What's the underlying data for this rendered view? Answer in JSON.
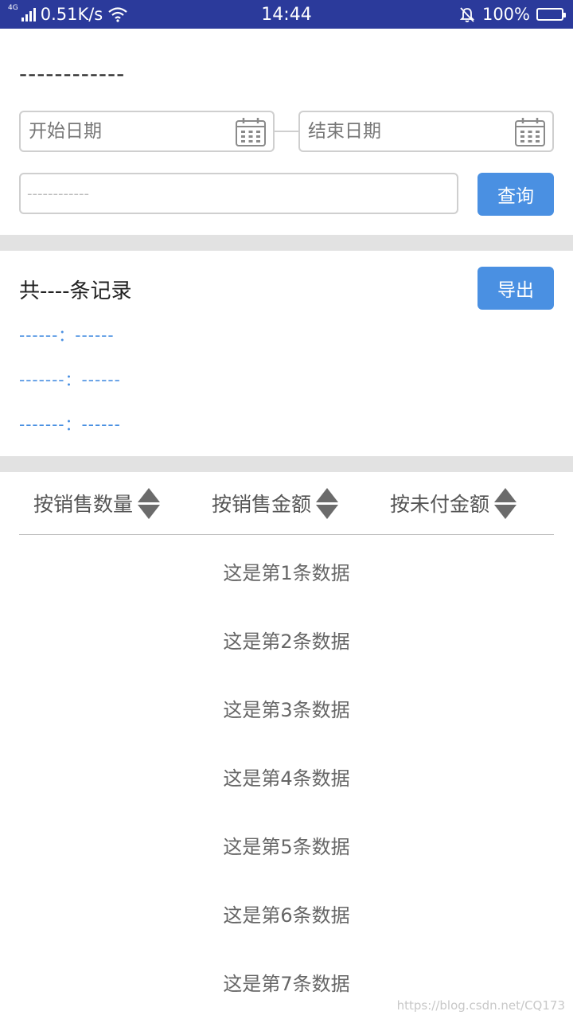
{
  "statusbar": {
    "network_type": "4G",
    "speed": "0.51K/s",
    "time": "14:44",
    "battery": "100%",
    "battery_level": 1.0
  },
  "filter": {
    "title": "------------",
    "start_date_placeholder": "开始日期",
    "end_date_placeholder": "结束日期",
    "search_placeholder": "------------",
    "query_label": "查询"
  },
  "summary": {
    "count_text": "共----条记录",
    "export_label": "导出",
    "lines": [
      "------：------",
      "-------：------",
      "-------：------"
    ]
  },
  "sort": {
    "options": [
      "按销售数量",
      "按销售金额",
      "按未付金额"
    ]
  },
  "list": {
    "items": [
      "这是第1条数据",
      "这是第2条数据",
      "这是第3条数据",
      "这是第4条数据",
      "这是第5条数据",
      "这是第6条数据",
      "这是第7条数据"
    ]
  },
  "watermark": "https://blog.csdn.net/CQ173",
  "colors": {
    "statusbar": "#2b3a9b",
    "accent": "#4a90e2",
    "divider": "#e2e2e2"
  }
}
